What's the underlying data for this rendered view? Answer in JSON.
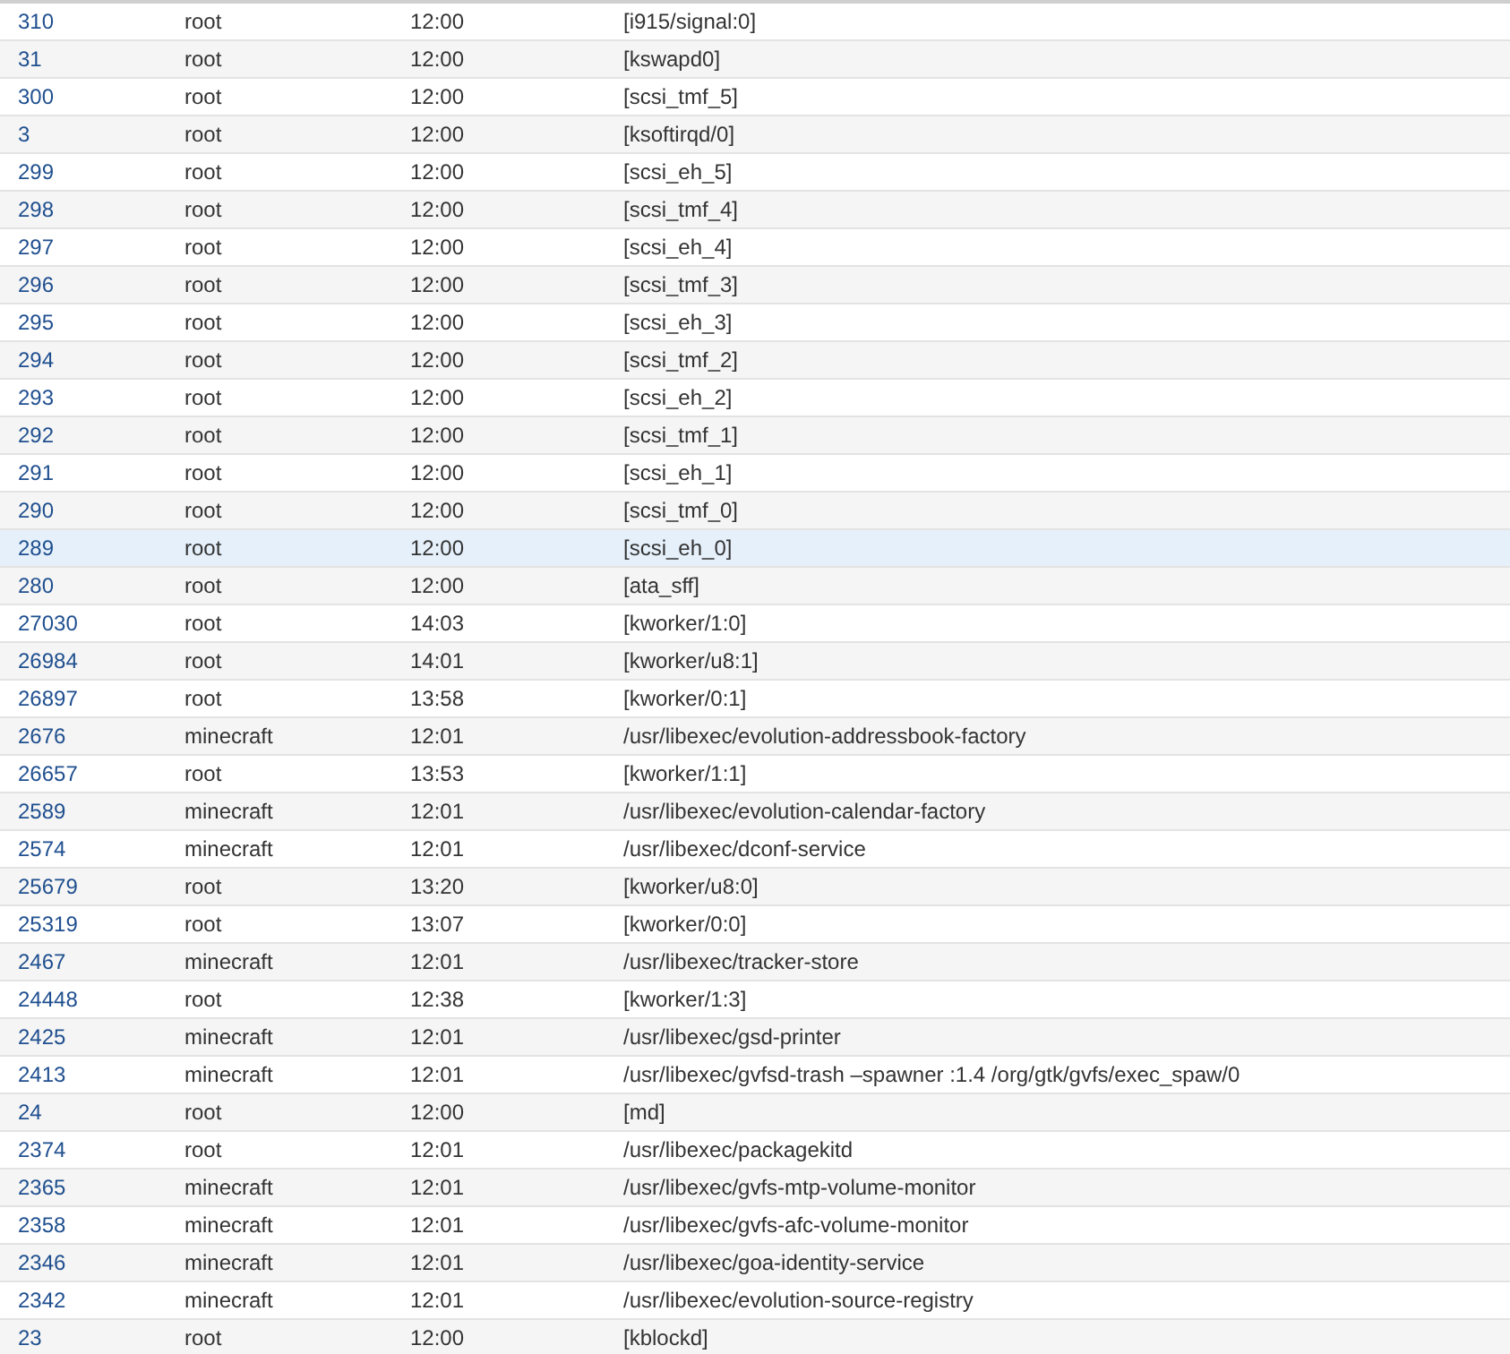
{
  "table": {
    "rows": [
      {
        "pid": "310",
        "user": "root",
        "time": "12:00",
        "command": "[i915/signal:0]",
        "selected": false
      },
      {
        "pid": "31",
        "user": "root",
        "time": "12:00",
        "command": "[kswapd0]",
        "selected": false
      },
      {
        "pid": "300",
        "user": "root",
        "time": "12:00",
        "command": "[scsi_tmf_5]",
        "selected": false
      },
      {
        "pid": "3",
        "user": "root",
        "time": "12:00",
        "command": "[ksoftirqd/0]",
        "selected": false
      },
      {
        "pid": "299",
        "user": "root",
        "time": "12:00",
        "command": "[scsi_eh_5]",
        "selected": false
      },
      {
        "pid": "298",
        "user": "root",
        "time": "12:00",
        "command": "[scsi_tmf_4]",
        "selected": false
      },
      {
        "pid": "297",
        "user": "root",
        "time": "12:00",
        "command": "[scsi_eh_4]",
        "selected": false
      },
      {
        "pid": "296",
        "user": "root",
        "time": "12:00",
        "command": "[scsi_tmf_3]",
        "selected": false
      },
      {
        "pid": "295",
        "user": "root",
        "time": "12:00",
        "command": "[scsi_eh_3]",
        "selected": false
      },
      {
        "pid": "294",
        "user": "root",
        "time": "12:00",
        "command": "[scsi_tmf_2]",
        "selected": false
      },
      {
        "pid": "293",
        "user": "root",
        "time": "12:00",
        "command": "[scsi_eh_2]",
        "selected": false
      },
      {
        "pid": "292",
        "user": "root",
        "time": "12:00",
        "command": "[scsi_tmf_1]",
        "selected": false
      },
      {
        "pid": "291",
        "user": "root",
        "time": "12:00",
        "command": "[scsi_eh_1]",
        "selected": false
      },
      {
        "pid": "290",
        "user": "root",
        "time": "12:00",
        "command": "[scsi_tmf_0]",
        "selected": false
      },
      {
        "pid": "289",
        "user": "root",
        "time": "12:00",
        "command": "[scsi_eh_0]",
        "selected": true
      },
      {
        "pid": "280",
        "user": "root",
        "time": "12:00",
        "command": "[ata_sff]",
        "selected": false
      },
      {
        "pid": "27030",
        "user": "root",
        "time": "14:03",
        "command": "[kworker/1:0]",
        "selected": false
      },
      {
        "pid": "26984",
        "user": "root",
        "time": "14:01",
        "command": "[kworker/u8:1]",
        "selected": false
      },
      {
        "pid": "26897",
        "user": "root",
        "time": "13:58",
        "command": "[kworker/0:1]",
        "selected": false
      },
      {
        "pid": "2676",
        "user": "minecraft",
        "time": "12:01",
        "command": "/usr/libexec/evolution-addressbook-factory",
        "selected": false
      },
      {
        "pid": "26657",
        "user": "root",
        "time": "13:53",
        "command": "[kworker/1:1]",
        "selected": false
      },
      {
        "pid": "2589",
        "user": "minecraft",
        "time": "12:01",
        "command": "/usr/libexec/evolution-calendar-factory",
        "selected": false
      },
      {
        "pid": "2574",
        "user": "minecraft",
        "time": "12:01",
        "command": "/usr/libexec/dconf-service",
        "selected": false
      },
      {
        "pid": "25679",
        "user": "root",
        "time": "13:20",
        "command": "[kworker/u8:0]",
        "selected": false
      },
      {
        "pid": "25319",
        "user": "root",
        "time": "13:07",
        "command": "[kworker/0:0]",
        "selected": false
      },
      {
        "pid": "2467",
        "user": "minecraft",
        "time": "12:01",
        "command": "/usr/libexec/tracker-store",
        "selected": false
      },
      {
        "pid": "24448",
        "user": "root",
        "time": "12:38",
        "command": "[kworker/1:3]",
        "selected": false
      },
      {
        "pid": "2425",
        "user": "minecraft",
        "time": "12:01",
        "command": "/usr/libexec/gsd-printer",
        "selected": false
      },
      {
        "pid": "2413",
        "user": "minecraft",
        "time": "12:01",
        "command": "/usr/libexec/gvfsd-trash –spawner :1.4 /org/gtk/gvfs/exec_spaw/0",
        "selected": false
      },
      {
        "pid": "24",
        "user": "root",
        "time": "12:00",
        "command": "[md]",
        "selected": false
      },
      {
        "pid": "2374",
        "user": "root",
        "time": "12:01",
        "command": "/usr/libexec/packagekitd",
        "selected": false
      },
      {
        "pid": "2365",
        "user": "minecraft",
        "time": "12:01",
        "command": "/usr/libexec/gvfs-mtp-volume-monitor",
        "selected": false
      },
      {
        "pid": "2358",
        "user": "minecraft",
        "time": "12:01",
        "command": "/usr/libexec/gvfs-afc-volume-monitor",
        "selected": false
      },
      {
        "pid": "2346",
        "user": "minecraft",
        "time": "12:01",
        "command": "/usr/libexec/goa-identity-service",
        "selected": false
      },
      {
        "pid": "2342",
        "user": "minecraft",
        "time": "12:01",
        "command": "/usr/libexec/evolution-source-registry",
        "selected": false
      },
      {
        "pid": "23",
        "user": "root",
        "time": "12:00",
        "command": "[kblockd]",
        "selected": false
      }
    ]
  }
}
